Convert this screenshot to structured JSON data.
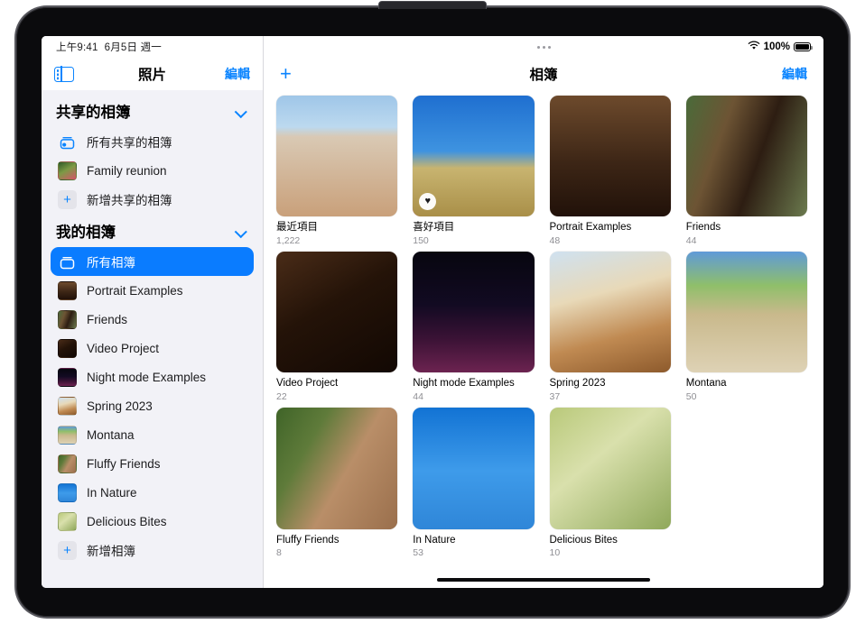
{
  "device": {
    "name": "ipad-pro"
  },
  "status_bar": {
    "time": "上午9:41",
    "date": "6月5日 週一",
    "battery_percent": "100%",
    "wifi_icon": "wifi-icon",
    "battery_icon": "battery-icon",
    "multitask_icon": "multitask-dots-icon"
  },
  "sidebar": {
    "toggle_icon": "sidebar-toggle-icon",
    "title": "照片",
    "edit_label": "編輯",
    "sections": [
      {
        "id": "shared-albums",
        "header": "共享的相簿",
        "chevron_icon": "chevron-down-icon",
        "items": [
          {
            "label": "所有共享的相簿",
            "icon": "shared-albums-icon",
            "type": "glyph"
          },
          {
            "label": "Family reunion",
            "icon": "album-thumbnail",
            "type": "thumb",
            "art": "family-reunion"
          },
          {
            "label": "新增共享的相簿",
            "icon": "plus-icon",
            "type": "plus"
          }
        ]
      },
      {
        "id": "my-albums",
        "header": "我的相簿",
        "chevron_icon": "chevron-down-icon",
        "items": [
          {
            "label": "所有相簿",
            "icon": "all-albums-icon",
            "type": "glyph",
            "selected": true
          },
          {
            "label": "Portrait Examples",
            "icon": "album-thumbnail",
            "type": "thumb",
            "art": "portrait"
          },
          {
            "label": "Friends",
            "icon": "album-thumbnail",
            "type": "thumb",
            "art": "friends"
          },
          {
            "label": "Video Project",
            "icon": "album-thumbnail",
            "type": "thumb",
            "art": "video"
          },
          {
            "label": "Night mode Examples",
            "icon": "album-thumbnail",
            "type": "thumb",
            "art": "night"
          },
          {
            "label": "Spring 2023",
            "icon": "album-thumbnail",
            "type": "thumb",
            "art": "spring"
          },
          {
            "label": "Montana",
            "icon": "album-thumbnail",
            "type": "thumb",
            "art": "montana"
          },
          {
            "label": "Fluffy Friends",
            "icon": "album-thumbnail",
            "type": "thumb",
            "art": "fluffy"
          },
          {
            "label": "In Nature",
            "icon": "album-thumbnail",
            "type": "thumb",
            "art": "nature"
          },
          {
            "label": "Delicious Bites",
            "icon": "album-thumbnail",
            "type": "thumb",
            "art": "bites"
          },
          {
            "label": "新增相簿",
            "icon": "plus-icon",
            "type": "plus"
          }
        ]
      }
    ]
  },
  "main": {
    "add_button_icon": "plus-icon",
    "title": "相簿",
    "edit_label": "編輯",
    "albums": [
      {
        "name": "最近項目",
        "count": "1,222",
        "art": "recents",
        "badge": null
      },
      {
        "name": "喜好項目",
        "count": "150",
        "art": "favorites",
        "badge": "heart-icon"
      },
      {
        "name": "Portrait Examples",
        "count": "48",
        "art": "portrait",
        "badge": null
      },
      {
        "name": "Friends",
        "count": "44",
        "art": "friends",
        "badge": null
      },
      {
        "name": "Video Project",
        "count": "22",
        "art": "video",
        "badge": null
      },
      {
        "name": "Night mode Examples",
        "count": "44",
        "art": "night",
        "badge": null
      },
      {
        "name": "Spring 2023",
        "count": "37",
        "art": "spring",
        "badge": null
      },
      {
        "name": "Montana",
        "count": "50",
        "art": "montana",
        "badge": null
      },
      {
        "name": "Fluffy Friends",
        "count": "8",
        "art": "fluffy",
        "badge": null
      },
      {
        "name": "In Nature",
        "count": "53",
        "art": "nature",
        "badge": null
      },
      {
        "name": "Delicious Bites",
        "count": "10",
        "art": "bites",
        "badge": null
      }
    ]
  },
  "home_indicator": {
    "icon": "home-indicator"
  },
  "colors": {
    "accent": "#0a84ff",
    "selected_row": "#0a7cff",
    "sidebar_bg": "#f2f2f7",
    "secondary_text": "#8e8e93",
    "screen_bg": "#ffffff"
  }
}
